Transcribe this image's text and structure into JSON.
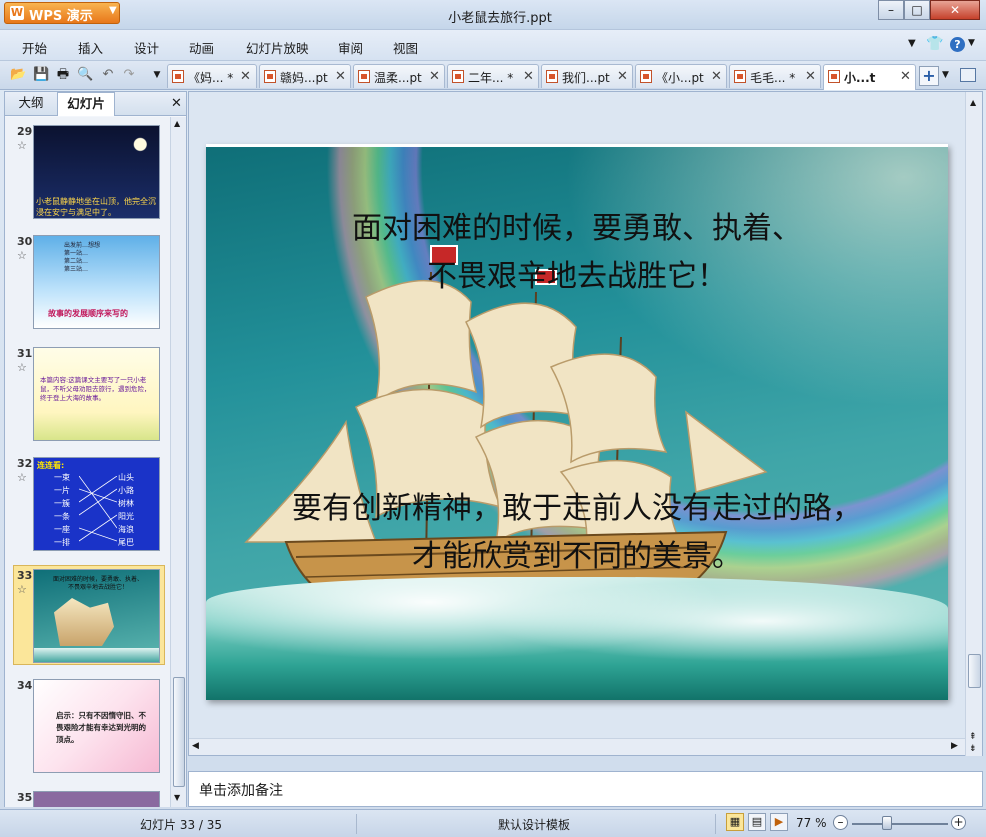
{
  "app": {
    "name": "WPS 演示",
    "doc_title": "小老鼠去旅行.ppt"
  },
  "menu": [
    "开始",
    "插入",
    "设计",
    "动画",
    "幻灯片放映",
    "审阅",
    "视图"
  ],
  "tabs": [
    "《妈... *",
    "赣妈...pt",
    "温柔...pt",
    "二年... *",
    "我们...pt",
    "《小...pt",
    "毛毛... *",
    "小...t"
  ],
  "panel": {
    "outline_tab": "大纲",
    "slides_tab": "幻灯片"
  },
  "thumbs": [
    {
      "num": "29",
      "text": "小老鼠静静地坐在山顶，他完全沉浸在安宁与满足中了。"
    },
    {
      "num": "30",
      "lines": [
        "出发前…想想",
        "第一站…",
        "第二站…",
        "第三站…"
      ],
      "caption": "故事的发展顺序来写的"
    },
    {
      "num": "31",
      "text": "本篇内容:这篇课文主要写了一只小老鼠，不听父母劝阻去旅行，遇到危险，终于登上大海的故事。"
    },
    {
      "num": "32",
      "title": "连连看:",
      "left": [
        "一束",
        "一片",
        "一簇",
        "一条",
        "一座",
        "一排"
      ],
      "right": [
        "山头",
        "小路",
        "树林",
        "阳光",
        "海浪",
        "尾巴"
      ]
    },
    {
      "num": "33",
      "text": "面对困难的时候，要勇敢、执着、不畏艰辛地去战胜它！"
    },
    {
      "num": "34",
      "text": "启示：只有不因惰守旧、不畏艰险才能有幸达到光明的顶点。"
    },
    {
      "num": "35"
    }
  ],
  "slide": {
    "line1": "面对困难的时候，要勇敢、执着、",
    "line2": "不畏艰辛地去战胜它！",
    "line3": "要有创新精神，敢于走前人没有走过的路，",
    "line4": "才能欣赏到不同的美景。"
  },
  "notes": {
    "placeholder": "单击添加备注"
  },
  "status": {
    "slide_counter": "幻灯片 33 / 35",
    "template": "默认设计模板",
    "zoom": "77 %"
  },
  "colors": {
    "accent": "#e8771a",
    "selection": "#fbe69a",
    "chrome": "#cfdcec"
  }
}
